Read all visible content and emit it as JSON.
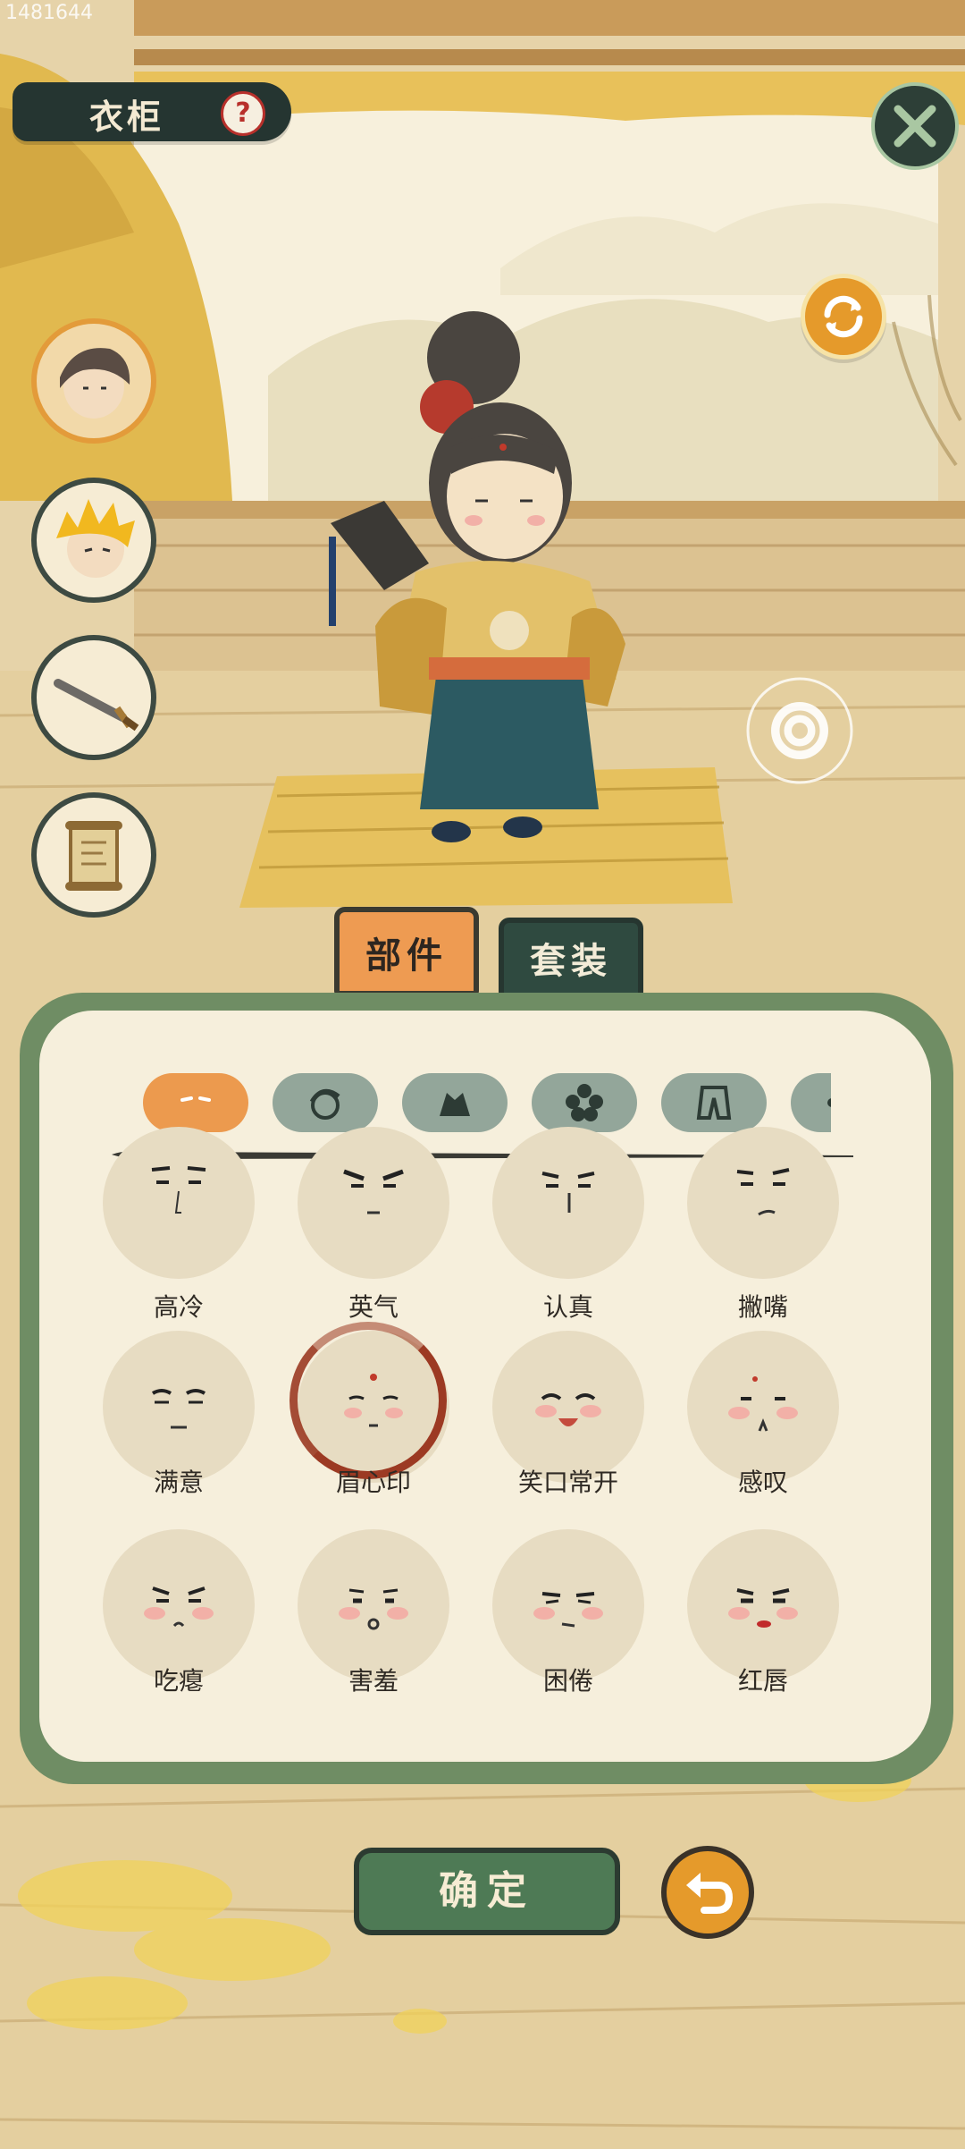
{
  "watermark": "1481644",
  "header": {
    "title": "衣柜",
    "help_glyph": "?"
  },
  "icons": {
    "close": "close-icon",
    "refresh": "refresh-icon",
    "help": "question-icon",
    "undo": "undo-icon"
  },
  "side_list": [
    "character-male-icon",
    "character-golden-hair-icon",
    "sword-icon",
    "scroll-icon"
  ],
  "tabs": {
    "parts": "部件",
    "sets": "套装"
  },
  "categories": [
    "expression-icon",
    "hair-icon",
    "clothing-icon",
    "flower-icon",
    "pants-icon",
    "more-icon"
  ],
  "items": [
    {
      "label": "高冷"
    },
    {
      "label": "英气"
    },
    {
      "label": "认真"
    },
    {
      "label": "撇嘴"
    },
    {
      "label": "满意"
    },
    {
      "label": "眉心印"
    },
    {
      "label": "笑口常开"
    },
    {
      "label": "感叹"
    },
    {
      "label": "吃瘪"
    },
    {
      "label": "害羞"
    },
    {
      "label": "困倦"
    },
    {
      "label": "红唇"
    }
  ],
  "selected_item": "眉心印",
  "footer": {
    "confirm": "确定"
  },
  "colors": {
    "accent_orange": "#ec9a4e",
    "panel_green": "#6f8d64",
    "dark_green": "#2f4a40",
    "selection_red": "#9c3a23"
  }
}
